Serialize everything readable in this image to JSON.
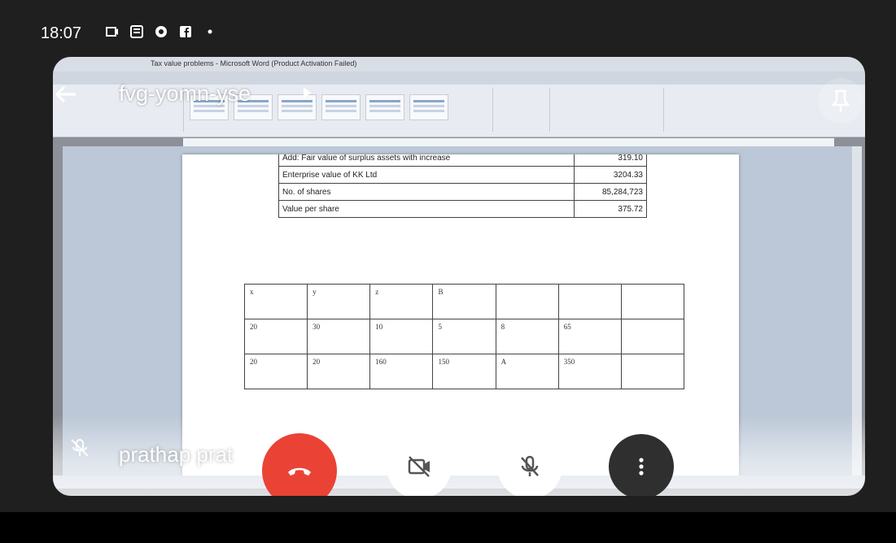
{
  "statusbar": {
    "time": "18:07",
    "icons": [
      "screen-cast-icon",
      "news-icon",
      "app-icon",
      "facebook-icon",
      "dot-icon"
    ]
  },
  "word": {
    "title": "Tax value problems - Microsoft Word (Product Activation Failed)",
    "top_table": [
      {
        "label": "Add: Fair value of surplus assets with increase",
        "value": "319.10"
      },
      {
        "label": "Enterprise value of KK Ltd",
        "value": "3204.33"
      },
      {
        "label": "No. of shares",
        "value": "85,284,723"
      },
      {
        "label": "Value per share",
        "value": "375.72"
      }
    ],
    "xyz_table": [
      [
        "x",
        "y",
        "z",
        "B",
        "",
        "",
        ""
      ],
      [
        "20",
        "30",
        "10",
        "5",
        "8",
        "65",
        ""
      ],
      [
        "20",
        "20",
        "160",
        "150",
        "A",
        "350",
        ""
      ]
    ]
  },
  "meet": {
    "meeting_code": "fvg-yomn-yse",
    "participant_name": "prathap prat",
    "accent_end_call": "#ea4335",
    "icons": {
      "back": "back-arrow-icon",
      "pin": "pin-icon",
      "end_call": "phone-hangup-icon",
      "camera": "camera-off-icon",
      "mic": "mic-off-icon",
      "more": "more-vertical-icon"
    }
  }
}
